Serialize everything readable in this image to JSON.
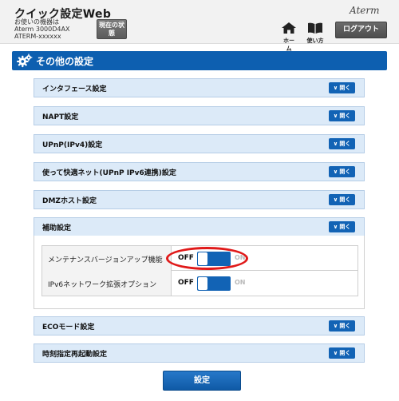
{
  "header": {
    "app_title": "クイック設定Web",
    "device_info": [
      "お使いの機器は",
      "Aterm 3000D4AX",
      "ATERM-xxxxxx"
    ],
    "status_button": "現在の状態",
    "nav_home_label": "ホーム",
    "nav_guide_label": "使い方",
    "logout_button": "ログアウト",
    "brand": "Aterm"
  },
  "section": {
    "title": "その他の設定"
  },
  "open_label": "開く",
  "accordion": [
    {
      "label": "インタフェース設定"
    },
    {
      "label": "NAPT設定"
    },
    {
      "label": "UPnP(IPv4)設定"
    },
    {
      "label": "使って快適ネット(UPnP IPv6連携)設定"
    },
    {
      "label": "DMZホスト設定"
    },
    {
      "label": "補助設定"
    }
  ],
  "auxiliary_settings": {
    "rows": [
      {
        "label": "メンテナンスバージョンアップ機能",
        "off_label": "OFF",
        "on_label": "ON",
        "state": "off"
      },
      {
        "label": "IPv6ネットワーク拡張オプション",
        "off_label": "OFF",
        "on_label": "ON",
        "state": "off"
      }
    ]
  },
  "accordion_bottom": [
    {
      "label": "ECOモード設定"
    },
    {
      "label": "時刻指定再起動設定"
    }
  ],
  "submit_button": "設定",
  "colors": {
    "accent": "#1263b5",
    "section_bar": "#0d5fb0",
    "row_bg": "#dceaf8",
    "highlight": "#e01919"
  },
  "icons": [
    "home-icon",
    "book-icon",
    "gear-icon",
    "chevron-down-icon"
  ]
}
